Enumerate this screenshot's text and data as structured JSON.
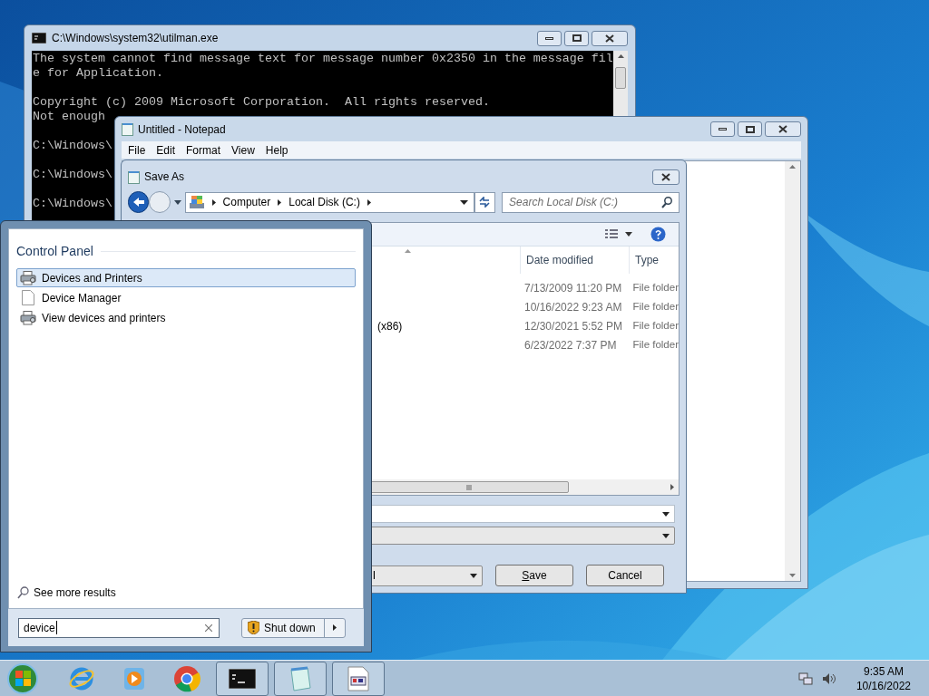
{
  "cmd_window": {
    "title": "C:\\Windows\\system32\\utilman.exe",
    "paragraphs": [
      [
        "The system cannot find message text for message number 0x2350 in the message fil",
        "e for Application."
      ],
      [
        "Copyright (c) 2009 Microsoft Corporation.  All rights reserved.",
        "Not enough"
      ],
      [
        "C:\\Windows\\"
      ],
      [
        "C:\\Windows\\"
      ],
      [
        "C:\\Windows\\"
      ]
    ]
  },
  "notepad": {
    "title": "Untitled - Notepad",
    "menu": [
      "File",
      "Edit",
      "Format",
      "View",
      "Help"
    ]
  },
  "save_dialog": {
    "title": "Save As",
    "breadcrumb": [
      "Computer",
      "Local Disk (C:)"
    ],
    "search": {
      "placeholder": "Search Local Disk (C:)"
    },
    "columns": [
      "Date modified",
      "Type"
    ],
    "rows": [
      {
        "date": "7/13/2009 11:20 PM",
        "type": "File folder"
      },
      {
        "date": "10/16/2022 9:23 AM",
        "type": "File folder"
      },
      {
        "name": "(x86)",
        "date": "12/30/2021 5:52 PM",
        "type": "File folder"
      },
      {
        "date": "6/23/2022 7:37 PM",
        "type": "File folder"
      }
    ],
    "encoding": "I",
    "buttons": [
      "Save",
      "Cancel"
    ]
  },
  "start_menu": {
    "section": "Control Panel",
    "results": [
      {
        "label": "Devices and Printers",
        "kind": "printer",
        "selected": true
      },
      {
        "label": "Device Manager",
        "kind": "document",
        "selected": false
      },
      {
        "label": "View devices and printers",
        "kind": "printer",
        "selected": false
      }
    ],
    "more": "See more results",
    "search": {
      "value": "device"
    },
    "shutdown": "Shut down"
  },
  "taskbar": {
    "apps": [
      {
        "kind": "ie",
        "running": false
      },
      {
        "kind": "media",
        "running": false
      },
      {
        "kind": "chrome",
        "running": false
      },
      {
        "kind": "cmd",
        "running": true
      },
      {
        "kind": "notepad",
        "running": true
      },
      {
        "kind": "window",
        "running": true
      }
    ],
    "time": "9:35 AM",
    "date": "10/16/2022"
  }
}
